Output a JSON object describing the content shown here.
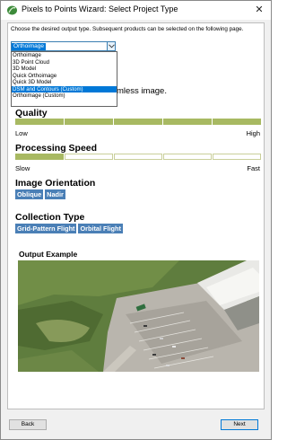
{
  "window": {
    "title": "Pixels to Points Wizard: Select Project Type",
    "close_glyph": "✕",
    "app_icon": "leaf-logo-icon"
  },
  "instruction": "Choose the desired output type. Subsequent products can be selected on the following page.",
  "project_type": {
    "selected_value": "Orthoimage",
    "options": [
      "Orthoimage",
      "3D Point Cloud",
      "3D Model",
      "Quick Orthoimage",
      "Quick 3D Model",
      "DSM and Contours (Custom)",
      "Orthoimage (Custom)"
    ],
    "highlighted_index": 5
  },
  "description": "mless image.",
  "quality": {
    "title": "Quality",
    "level": 5,
    "max": 5,
    "low_label": "Low",
    "high_label": "High"
  },
  "processing_speed": {
    "title": "Processing Speed",
    "level": 1,
    "max": 5,
    "low_label": "Slow",
    "high_label": "Fast"
  },
  "image_orientation": {
    "title": "Image Orientation",
    "tags": [
      "Oblique",
      "Nadir"
    ]
  },
  "collection_type": {
    "title": "Collection Type",
    "tags": [
      "Grid-Pattern Flight",
      "Orbital Flight"
    ]
  },
  "output_example": {
    "title": "Output Example"
  },
  "buttons": {
    "back": "Back",
    "next": "Next"
  },
  "colors": {
    "rating_on": "#a8b962",
    "tag_bg": "#4a7fb6",
    "selection": "#0078d7"
  }
}
